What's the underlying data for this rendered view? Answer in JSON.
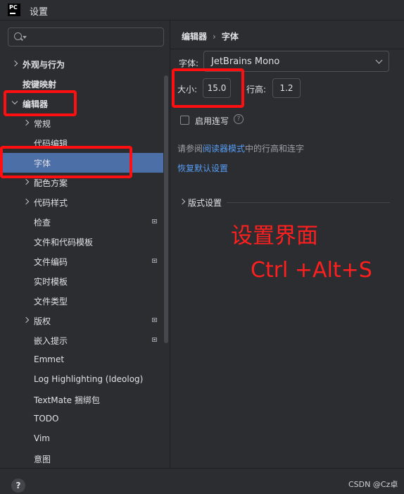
{
  "window": {
    "app_icon_text": "PC",
    "title": "设置"
  },
  "search": {
    "value": "",
    "placeholder": ""
  },
  "tree": [
    {
      "label": "外观与行为",
      "chevron": "right",
      "bold": true
    },
    {
      "label": "按键映射",
      "chevron": "",
      "bold": true
    },
    {
      "label": "编辑器",
      "chevron": "down",
      "bold": true
    },
    {
      "label": "常规",
      "chevron": "right"
    },
    {
      "label": "代码编辑",
      "chevron": ""
    },
    {
      "label": "字体",
      "chevron": "",
      "selected": true
    },
    {
      "label": "配色方案",
      "chevron": "right"
    },
    {
      "label": "代码样式",
      "chevron": "right"
    },
    {
      "label": "检查",
      "chevron": "",
      "badge": true
    },
    {
      "label": "文件和代码模板",
      "chevron": ""
    },
    {
      "label": "文件编码",
      "chevron": "",
      "badge": true
    },
    {
      "label": "实时模板",
      "chevron": ""
    },
    {
      "label": "文件类型",
      "chevron": ""
    },
    {
      "label": "版权",
      "chevron": "right",
      "badge": true
    },
    {
      "label": "嵌入提示",
      "chevron": "",
      "badge": true
    },
    {
      "label": "Emmet",
      "chevron": ""
    },
    {
      "label": "Log Highlighting (Ideolog)",
      "chevron": ""
    },
    {
      "label": "TextMate 捆绑包",
      "chevron": ""
    },
    {
      "label": "TODO",
      "chevron": ""
    },
    {
      "label": "Vim",
      "chevron": ""
    },
    {
      "label": "意图",
      "chevron": ""
    }
  ],
  "breadcrumb": {
    "parent": "编辑器",
    "separator": "›",
    "current": "字体"
  },
  "font": {
    "label": "字体:",
    "value": "JetBrains Mono",
    "size_label": "大小:",
    "size_value": "15.0",
    "line_height_label": "行高:",
    "line_height_value": "1.2",
    "ligatures_label": "启用连写",
    "ligatures_checked": false,
    "help_glyph": "?"
  },
  "reader": {
    "prefix": "请参阅",
    "link": "阅读器模式",
    "suffix": "中的行高和连字"
  },
  "restore_defaults": "恢复默认设置",
  "layout_settings": "版式设置",
  "annotations": {
    "line1": "设置界面",
    "line2": "Ctrl +Alt+S"
  },
  "footer": {
    "help_glyph": "?",
    "watermark": "CSDN @Cz卓"
  },
  "colors": {
    "background": "#2b2d30",
    "selection": "#4c6fa8",
    "link": "#589df6",
    "annotation_red": "#ff0f0f"
  }
}
